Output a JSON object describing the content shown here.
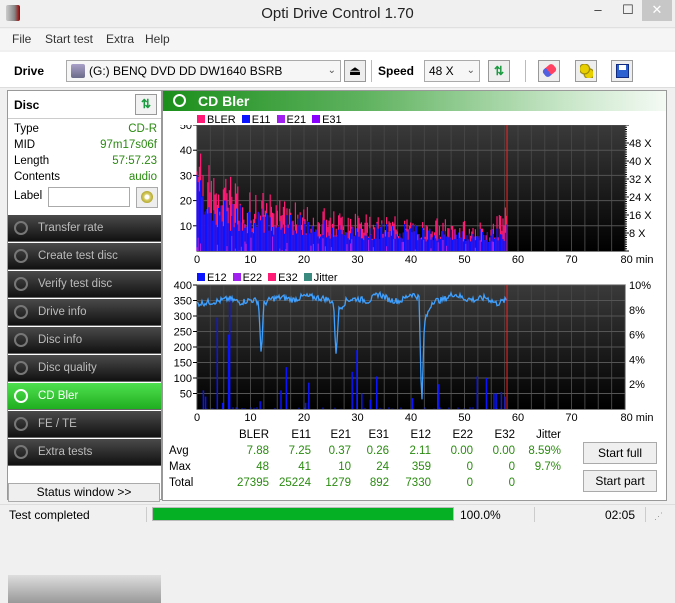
{
  "window": {
    "title": "Opti Drive Control 1.70",
    "minimize": "–",
    "maximize": "☐",
    "close": "✕"
  },
  "menu": [
    "File",
    "Start test",
    "Extra",
    "Help"
  ],
  "toolbar": {
    "drive_label": "Drive",
    "drive_value": "(G:)  BENQ DVD DD DW1640 BSRB",
    "speed_label": "Speed",
    "speed_value": "48 X",
    "eject_icon": "⏏",
    "refresh_icon": "⇅"
  },
  "disc": {
    "title": "Disc",
    "rows": [
      {
        "key": "Type",
        "value": "CD-R"
      },
      {
        "key": "MID",
        "value": "97m17s06f"
      },
      {
        "key": "Length",
        "value": "57:57.23"
      },
      {
        "key": "Contents",
        "value": "audio"
      }
    ],
    "label_key": "Label",
    "label_value": ""
  },
  "nav": [
    {
      "label": "Transfer rate",
      "active": false
    },
    {
      "label": "Create test disc",
      "active": false
    },
    {
      "label": "Verify test disc",
      "active": false
    },
    {
      "label": "Drive info",
      "active": false
    },
    {
      "label": "Disc info",
      "active": false
    },
    {
      "label": "Disc quality",
      "active": false
    },
    {
      "label": "CD Bler",
      "active": true
    },
    {
      "label": "FE / TE",
      "active": false
    },
    {
      "label": "Extra tests",
      "active": false
    }
  ],
  "status_window_button": "Status window >>",
  "main": {
    "title": "CD Bler"
  },
  "chart_data": [
    {
      "type": "bar",
      "title": "BLER / E11 / E21 / E31",
      "legend": [
        {
          "name": "BLER",
          "color": "#ff1a75"
        },
        {
          "name": "E11",
          "color": "#0a14ff"
        },
        {
          "name": "E21",
          "color": "#a020f0"
        },
        {
          "name": "E31",
          "color": "#8a00ff"
        }
      ],
      "x_range": [
        0,
        80
      ],
      "x_unit": "min",
      "x_ticks": [
        "0",
        "10",
        "20",
        "30",
        "40",
        "50",
        "60",
        "70",
        "80 min"
      ],
      "y_range": [
        0,
        50
      ],
      "y_ticks": [
        "10",
        "20",
        "30",
        "40",
        "50"
      ],
      "y2_ticks": [
        "8 X",
        "16 X",
        "24 X",
        "32 X",
        "40 X",
        "48 X"
      ],
      "y2_range": [
        0,
        56
      ],
      "end_marker_min": 57.95,
      "envelope": {
        "x": [
          0,
          1,
          2,
          4,
          6,
          10,
          15,
          20,
          25,
          30,
          35,
          40,
          45,
          50,
          55,
          57.9
        ],
        "bler": [
          44,
          40,
          32,
          26,
          28,
          22,
          20,
          17,
          15,
          14,
          13,
          12,
          12,
          11,
          10,
          18
        ],
        "e11": [
          38,
          30,
          25,
          20,
          20,
          17,
          15,
          13,
          12,
          11,
          10,
          10,
          9,
          9,
          8,
          10
        ]
      },
      "grid": true
    },
    {
      "type": "bar+line",
      "title": "E12 / E22 / E32 / Jitter",
      "legend": [
        {
          "name": "E12",
          "color": "#0a14ff"
        },
        {
          "name": "E22",
          "color": "#a020f0"
        },
        {
          "name": "E32",
          "color": "#ff1a75"
        },
        {
          "name": "Jitter",
          "color": "#3a8a80"
        }
      ],
      "x_range": [
        0,
        80
      ],
      "x_ticks": [
        "0",
        "10",
        "20",
        "30",
        "40",
        "50",
        "60",
        "70",
        "80 min"
      ],
      "y_range": [
        0,
        400
      ],
      "y_ticks": [
        "50",
        "100",
        "150",
        "200",
        "250",
        "300",
        "350",
        "400"
      ],
      "y2_range": [
        0,
        10
      ],
      "y2_ticks": [
        "2%",
        "4%",
        "6%",
        "8%",
        "10%"
      ],
      "end_marker_min": 57.95,
      "e12_spikes": [
        {
          "x": 1.2,
          "y": 60
        },
        {
          "x": 1.6,
          "y": 40
        },
        {
          "x": 3.8,
          "y": 295
        },
        {
          "x": 4.8,
          "y": 20
        },
        {
          "x": 5.9,
          "y": 240
        },
        {
          "x": 6.1,
          "y": 359
        },
        {
          "x": 11.8,
          "y": 25
        },
        {
          "x": 15.7,
          "y": 60
        },
        {
          "x": 16.7,
          "y": 135
        },
        {
          "x": 20.9,
          "y": 85
        },
        {
          "x": 20.3,
          "y": 20
        },
        {
          "x": 29,
          "y": 120
        },
        {
          "x": 29.9,
          "y": 190
        },
        {
          "x": 30.8,
          "y": 50
        },
        {
          "x": 33.6,
          "y": 105
        },
        {
          "x": 32.4,
          "y": 30
        },
        {
          "x": 40.3,
          "y": 35
        },
        {
          "x": 45.2,
          "y": 80
        },
        {
          "x": 52.4,
          "y": 105
        },
        {
          "x": 54.1,
          "y": 100
        },
        {
          "x": 55.5,
          "y": 50
        },
        {
          "x": 55.9,
          "y": 50
        },
        {
          "x": 56.9,
          "y": 55
        },
        {
          "x": 57.6,
          "y": 40
        }
      ],
      "jitter_pct": {
        "x": [
          0,
          2,
          4,
          6,
          8,
          10,
          11.5,
          12,
          12.5,
          14,
          16,
          18,
          20,
          22,
          24,
          25.5,
          26,
          26.5,
          28,
          30,
          32,
          34,
          36,
          38,
          40,
          41.5,
          42,
          42.5,
          44,
          46,
          48,
          50,
          52,
          54,
          56,
          57.9
        ],
        "y": [
          8.5,
          8.6,
          8.7,
          8.9,
          8.6,
          8.8,
          8.7,
          4.3,
          8.5,
          8.9,
          9.0,
          8.8,
          9.1,
          9.0,
          8.9,
          8.6,
          4.3,
          8.0,
          8.8,
          8.9,
          8.7,
          9.3,
          8.8,
          8.7,
          9.3,
          9.0,
          0,
          7.0,
          8.7,
          8.8,
          9.3,
          8.9,
          8.8,
          9.0,
          8.5,
          8.8
        ]
      },
      "grid": true
    }
  ],
  "stats": {
    "columns": [
      "BLER",
      "E11",
      "E21",
      "E31",
      "E12",
      "E22",
      "E32",
      "Jitter"
    ],
    "rows": [
      {
        "label": "Avg",
        "values": [
          "7.88",
          "7.25",
          "0.37",
          "0.26",
          "2.11",
          "0.00",
          "0.00",
          "8.59%"
        ]
      },
      {
        "label": "Max",
        "values": [
          "48",
          "41",
          "10",
          "24",
          "359",
          "0",
          "0",
          "9.7%"
        ]
      },
      {
        "label": "Total",
        "values": [
          "27395",
          "25224",
          "1279",
          "892",
          "7330",
          "0",
          "0",
          ""
        ]
      }
    ]
  },
  "buttons": {
    "start_full": "Start full",
    "start_part": "Start part"
  },
  "statusbar": {
    "text": "Test completed",
    "progress": 1.0,
    "progress_text": "100.0%",
    "time": "02:05"
  }
}
